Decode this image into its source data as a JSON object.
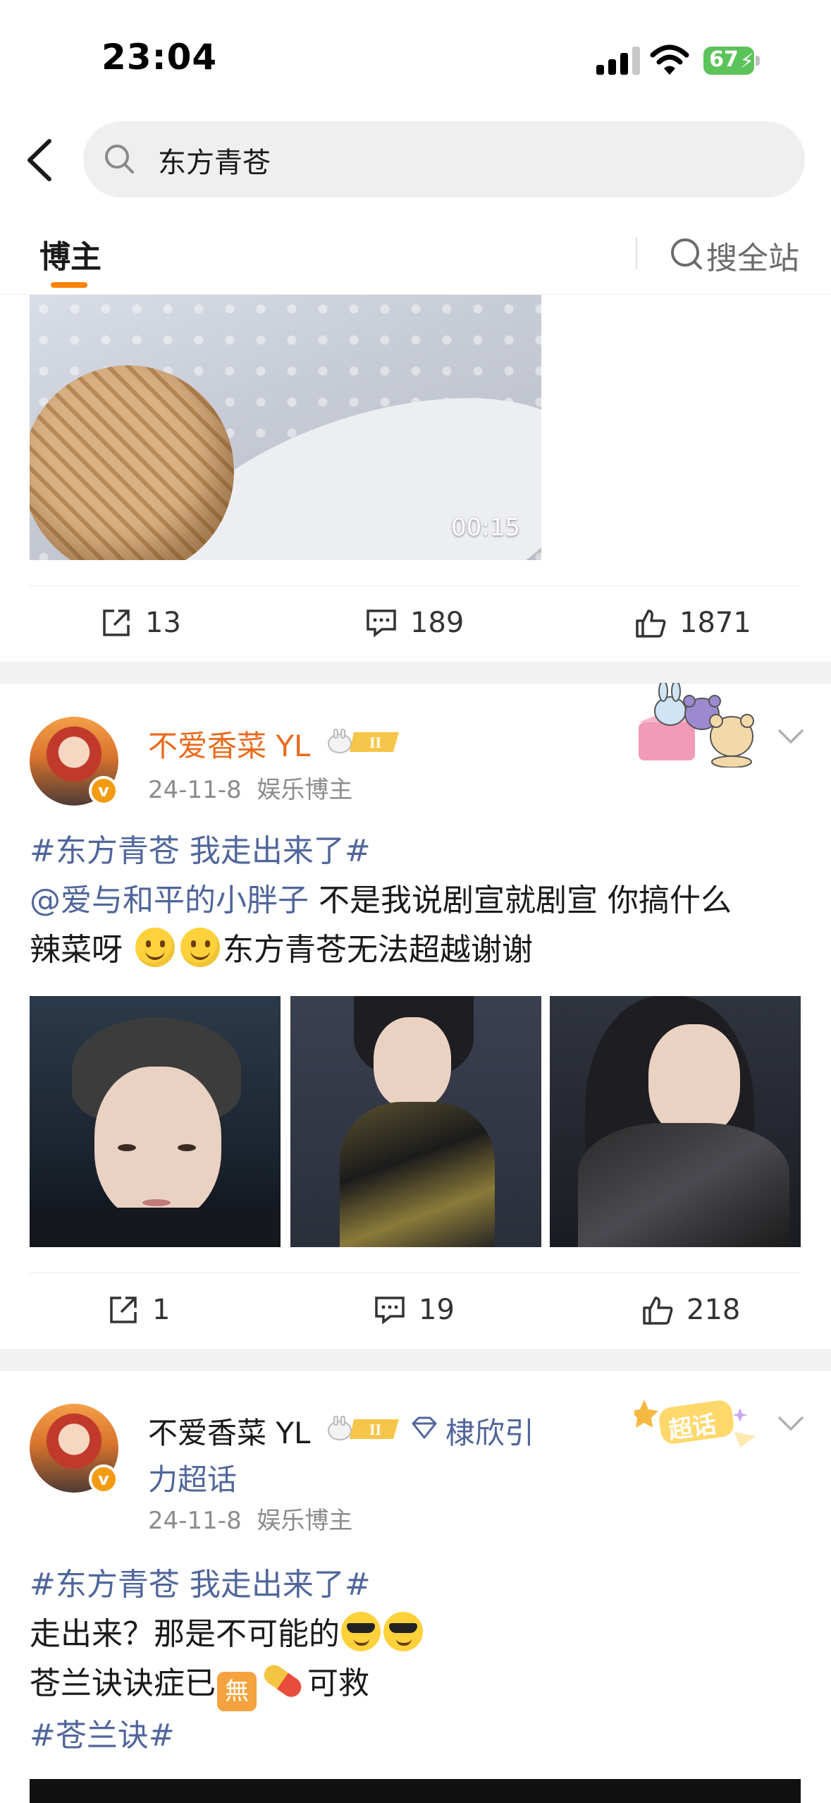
{
  "status_bar": {
    "time": "23:04",
    "battery": "67"
  },
  "search": {
    "query": "东方青苍"
  },
  "tabs": {
    "blogger_tab": "博主",
    "site_search": "搜全站"
  },
  "video_post": {
    "duration": "00:15",
    "reposts": "13",
    "comments": "189",
    "likes": "1871"
  },
  "post1": {
    "user_name": "不爱香菜 YL",
    "date": "24-11-8",
    "category": "娱乐博主",
    "topic": "#东方青苍 我走出来了#",
    "mention": "@爱与和平的小胖子",
    "text_part1": " 不是我说剧宣就剧宣 你搞什么",
    "text_part2": "辣菜呀 ",
    "text_part3": "东方青苍无法超越谢谢",
    "reposts": "1",
    "comments": "19",
    "likes": "218"
  },
  "post2": {
    "user_name": "不爱香菜 YL",
    "supertopic_name": "棣欣引",
    "supertopic_name_cont": "力超话",
    "sticker_text": "超话",
    "date": "24-11-8",
    "category": "娱乐博主",
    "topic": "#东方青苍 我走出来了#",
    "line2": "走出来？那是不可能的",
    "line3_a": "苍兰诀诀症已",
    "emoji_wu": "無",
    "line3_b": "可救",
    "topic2": "#苍兰诀#"
  },
  "colors": {
    "accent": "#ff8200",
    "link": "#50669b",
    "username_orange": "#e86b1d"
  }
}
